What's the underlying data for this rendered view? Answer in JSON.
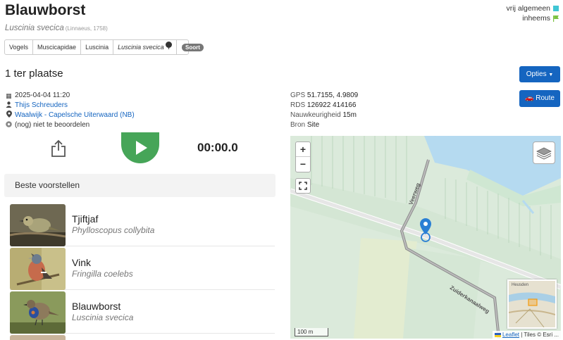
{
  "species": {
    "title": "Blauwborst",
    "scientific": "Luscinia svecica",
    "author": "(Linnaeus, 1758)"
  },
  "status": {
    "rarity": "vrij algemeen",
    "origin": "inheems",
    "rarity_color": "#3fc6d4",
    "origin_color": "#7cc242"
  },
  "taxonomy": {
    "items": [
      "Vogels",
      "Muscicapidae",
      "Luscinia",
      "Luscinia svecica"
    ],
    "badge": "Soort"
  },
  "observation": {
    "count": "1 ter plaatse",
    "datetime": "2025-04-04 11:20",
    "observer": "Thijs Schreuders",
    "location": "Waalwijk - Capelsche Uiterwaard (NB)",
    "review": "(nog) niet te beoordelen"
  },
  "geo": {
    "gps_label": "GPS",
    "gps_value": "51.7155, 4.9809",
    "rds_label": "RDS",
    "rds_value": "126922 414166",
    "accuracy_label": "Nauwkeurigheid",
    "accuracy_value": "15m",
    "source_label": "Bron",
    "source_value": "Site"
  },
  "buttons": {
    "options": "Opties",
    "route": "Route"
  },
  "player": {
    "time": "00:00.0"
  },
  "suggestions": {
    "heading": "Beste voorstellen",
    "items": [
      {
        "name": "Tjiftjaf",
        "latin": "Phylloscopus collybita"
      },
      {
        "name": "Vink",
        "latin": "Fringilla coelebs"
      },
      {
        "name": "Blauwborst",
        "latin": "Luscinia svecica"
      }
    ]
  },
  "map": {
    "zoom_in": "+",
    "zoom_out": "−",
    "scale": "100 m",
    "road1": "Veerweg",
    "road2": "Zuiderkanaalweg",
    "minimap_label": "Heusden",
    "attribution_link": "Leaflet",
    "attribution_text": "| Tiles © Esri ..."
  }
}
